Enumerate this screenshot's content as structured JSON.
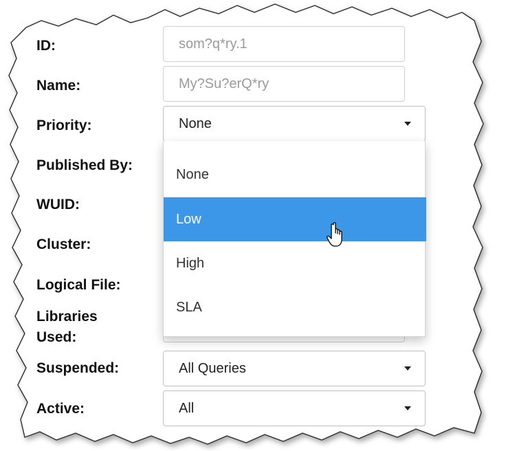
{
  "fields": {
    "id": {
      "label": "ID:",
      "placeholder": "som?q*ry.1"
    },
    "name": {
      "label": "Name:",
      "placeholder": "My?Su?erQ*ry"
    },
    "priority": {
      "label": "Priority:",
      "value": "None"
    },
    "published_by": {
      "label": "Published By:"
    },
    "wuid": {
      "label": "WUID:"
    },
    "cluster": {
      "label": "Cluster:"
    },
    "logical_file": {
      "label": "Logical File:"
    },
    "libraries_used": {
      "label_line1": "Libraries",
      "label_line2": "Used:"
    },
    "suspended": {
      "label": "Suspended:",
      "value": "All Queries"
    },
    "active": {
      "label": "Active:",
      "value": "All"
    }
  },
  "priority_dropdown": {
    "options": [
      "None",
      "Low",
      "High",
      "SLA"
    ],
    "highlighted": "Low"
  },
  "colors": {
    "highlight": "#3d97e8",
    "label_text": "#111111",
    "placeholder_text": "#9a9a9a"
  },
  "icons": [
    "hand-pointer-cursor-icon",
    "caret-down-icon"
  ]
}
